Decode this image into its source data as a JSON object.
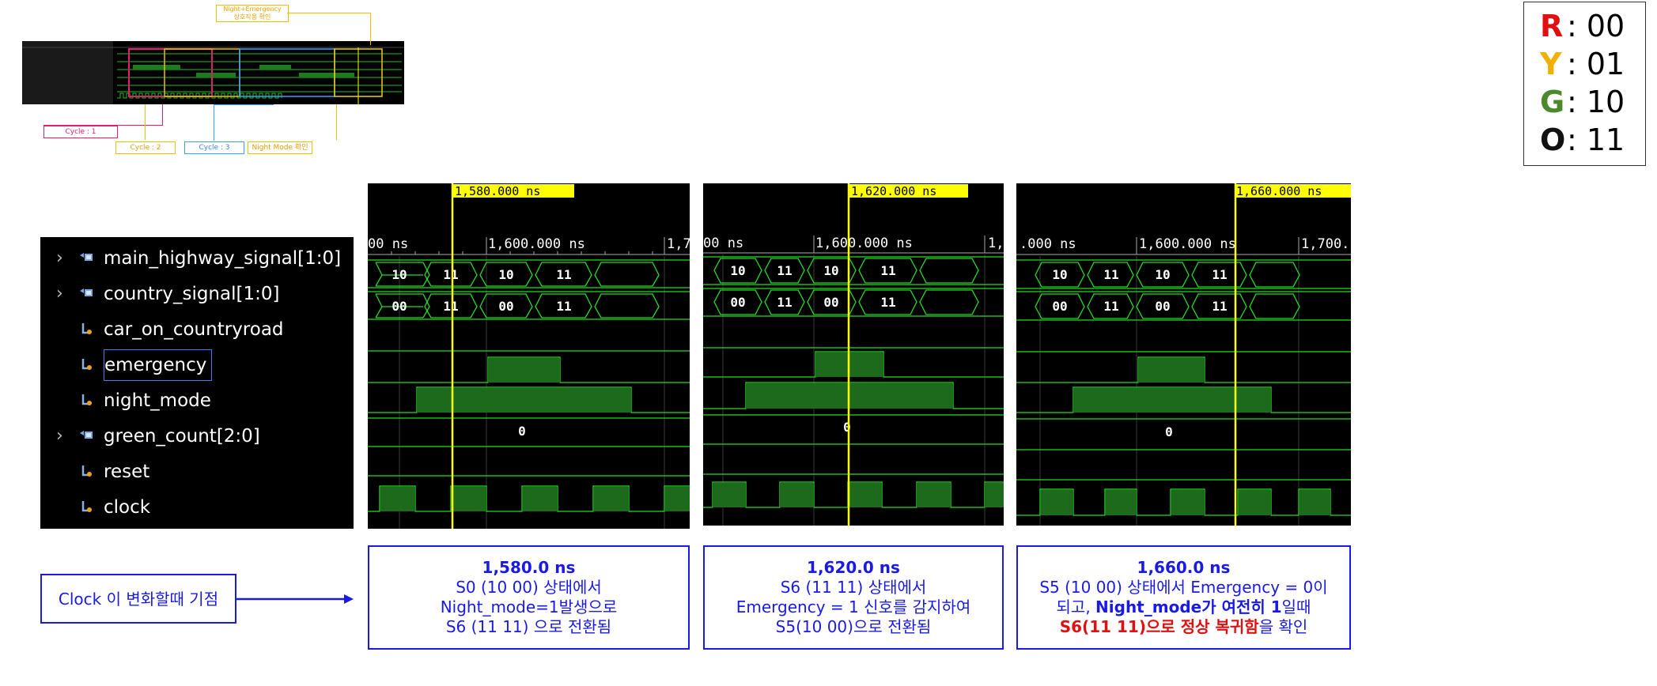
{
  "legend": [
    {
      "letter": "R",
      "value": ": 00",
      "color": "#e01010"
    },
    {
      "letter": "Y",
      "value": ": 01",
      "color": "#f0b000"
    },
    {
      "letter": "G",
      "value": ": 10",
      "color": "#4a8a2a"
    },
    {
      "letter": "O",
      "value": ": 11",
      "color": "#111111"
    }
  ],
  "overview": {
    "callouts": {
      "night_emergency": "Night+Emergency\n상호작용 확인",
      "cycle1": "Cycle : 1",
      "cycle2": "Cycle : 2",
      "cycle3": "Cycle : 3",
      "night_mode": "Night Mode 확인"
    }
  },
  "signals": [
    {
      "name": "main_highway_signal[1:0]",
      "expandable": true,
      "icon": "bus-icon"
    },
    {
      "name": "country_signal[1:0]",
      "expandable": true,
      "icon": "bus-icon"
    },
    {
      "name": "car_on_countryroad",
      "expandable": false,
      "icon": "wire-icon"
    },
    {
      "name": "emergency",
      "expandable": false,
      "icon": "wire-icon",
      "selected": true
    },
    {
      "name": "night_mode",
      "expandable": false,
      "icon": "wire-icon"
    },
    {
      "name": "green_count[2:0]",
      "expandable": true,
      "icon": "bus-icon"
    },
    {
      "name": "reset",
      "expandable": false,
      "icon": "wire-icon"
    },
    {
      "name": "clock",
      "expandable": false,
      "icon": "wire-icon"
    }
  ],
  "panels": [
    {
      "cursor_label": "1,580.000 ns",
      "tick_left": "00 ns",
      "tick_mid": "1,600.000 ns",
      "tick_right": "1,7",
      "main_values": [
        "10",
        "11",
        "10",
        "11"
      ],
      "country_values": [
        "00",
        "11",
        "00",
        "11"
      ],
      "green_count": "0",
      "desc": {
        "time": "1,580.0 ns",
        "line1": "S0 (10 00) 상태에서",
        "line2": "Night_mode=1발생으로",
        "line3": "S6 (11 11) 으로 전환됨"
      }
    },
    {
      "cursor_label": "1,620.000 ns",
      "tick_left": "00 ns",
      "tick_mid": "1,600.000 ns",
      "tick_right": "1,",
      "main_values": [
        "10",
        "11",
        "10",
        "11"
      ],
      "country_values": [
        "00",
        "11",
        "00",
        "11"
      ],
      "green_count": "0",
      "desc": {
        "time": "1,620.0 ns",
        "line1": "S6 (11 11) 상태에서",
        "line2": "Emergency = 1 신호를 감지하여",
        "line3": "S5(10 00)으로 전환됨"
      }
    },
    {
      "cursor_label": "1,660.000 ns",
      "tick_left": ".000 ns",
      "tick_mid": "1,600.000 ns",
      "tick_right": "1,700.",
      "main_values": [
        "10",
        "11",
        "10",
        "11"
      ],
      "country_values": [
        "00",
        "11",
        "00",
        "11"
      ],
      "green_count": "0",
      "desc": {
        "time": "1,660.0 ns",
        "line1": "S5 (10 00) 상태에서 Emergency = 0이",
        "line2a": "되고, ",
        "line2b": "Night_mode가 여전히 1",
        "line2c": "일때",
        "line3a": "S6(11 11)으로 정상 복귀함",
        "line3b": "을 확인"
      }
    }
  ],
  "note": "Clock 이 변화할때 기점"
}
